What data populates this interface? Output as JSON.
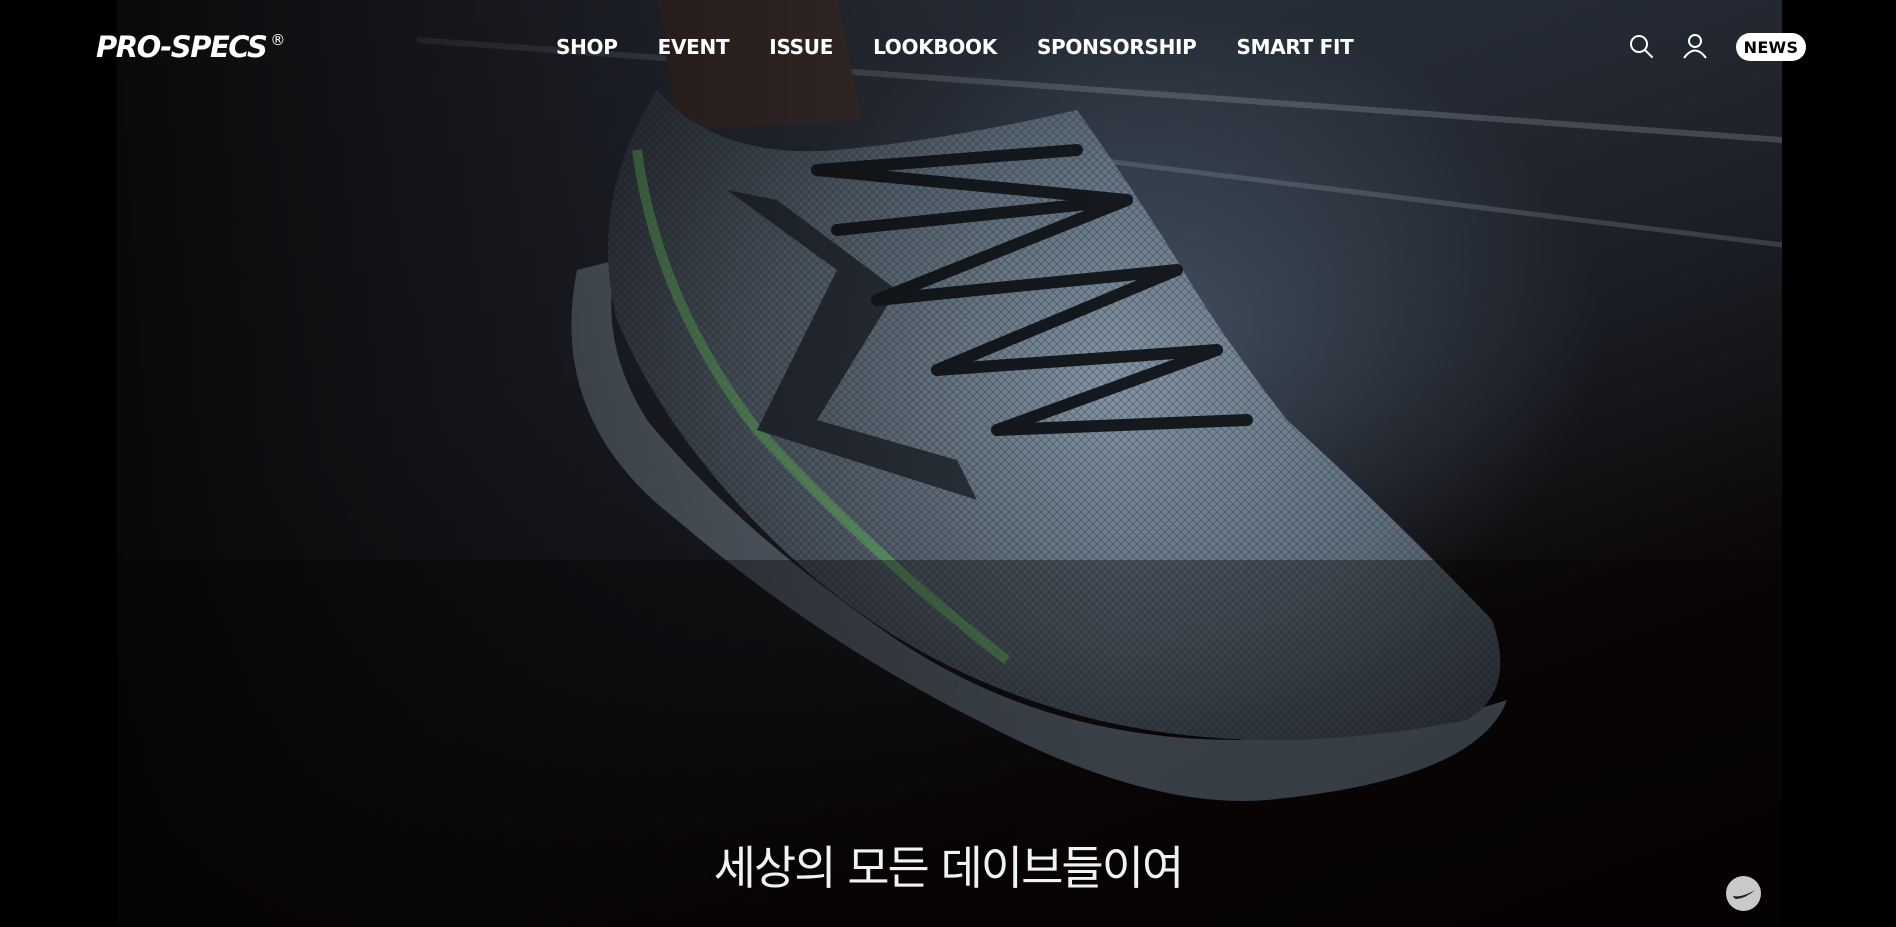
{
  "brand": {
    "logo_text": "PRO-SPECS",
    "registered_mark": "®"
  },
  "nav": {
    "items": [
      {
        "label": "SHOP"
      },
      {
        "label": "EVENT"
      },
      {
        "label": "ISSUE"
      },
      {
        "label": "LOOKBOOK"
      },
      {
        "label": "SPONSORSHIP"
      },
      {
        "label": "SMART FIT"
      }
    ]
  },
  "utilities": {
    "search_icon": "search-icon",
    "user_icon": "user-icon",
    "news_label": "NEWS"
  },
  "hero": {
    "subtitle": "세상의 모든 데이브들이여",
    "image": "running-shoe-on-track"
  },
  "floating_button": {
    "icon": "prospecs-swoosh-icon"
  },
  "colors": {
    "background": "#000000",
    "text": "#ffffff",
    "news_badge_bg": "#ffffff",
    "news_badge_text": "#000000",
    "shoe_accent": "#6fd36b"
  }
}
